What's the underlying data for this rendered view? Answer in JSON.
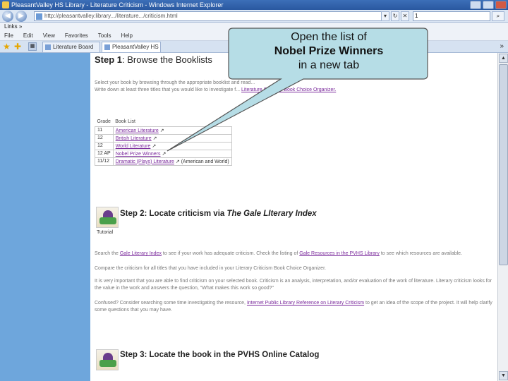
{
  "window": {
    "title": "PleasantValley HS Library - Literature Criticism - Windows Internet Explorer"
  },
  "address_bar": {
    "url": "http://pleasantvalley.library.../literature.../criticism.html",
    "search_value": "1"
  },
  "links_bar": {
    "label": "Links »"
  },
  "menu": [
    "File",
    "Edit",
    "View",
    "Favorites",
    "Tools",
    "Help"
  ],
  "tabs": [
    {
      "label": "Literature Board"
    },
    {
      "label": "PleasantValley HS Library"
    }
  ],
  "step1": {
    "number_label": "Step 1",
    "title_rest": ": Browse the Booklists",
    "instructions_line1": "Select your book by browsing through the appropriate booklist and read...",
    "instructions_line2_prefix": "Write down at least three titles that you would like to investigate f...",
    "organizer_link": "Literature Criticism Book Choice Organizer.",
    "table": {
      "headers": [
        "Grade",
        "Book List"
      ],
      "rows": [
        {
          "grade": "11",
          "list": "American Literature"
        },
        {
          "grade": "12",
          "list": "British Literature"
        },
        {
          "grade": "12",
          "list": "World Literature"
        },
        {
          "grade": "12 AP",
          "list": "Nobel Prize Winners"
        },
        {
          "grade": "11/12",
          "list": "Dramatic (Plays) Literature",
          "note": "(American and World)"
        }
      ]
    }
  },
  "step2": {
    "heading_prefix": "Step 2: Locate criticism via ",
    "heading_italic": "The Gale LIterary Index",
    "tutorial_label": "Tutorial",
    "para1_prefix": "Search the ",
    "para1_link1": "Gale Literary Index",
    "para1_mid": " to see if your work has adequate criticism. Check the listing of ",
    "para1_link2": "Gale Resources in the PVHS Library",
    "para1_suffix": " to see which resources are available.",
    "para2": "Compare the criticism for all titles that you have included in your Literary Criticism Book Choice Organizer.",
    "para3": "It is very important that you are able to find criticism on your selected book. Criticism is an analysis, interpretation, and/or evaluation of the work of literature. Literary criticism looks for the value in the work and answers the question, \"What makes this work so good?\"",
    "para4_prefix": "Confused? Consider searching some time investigating the resource, ",
    "para4_link": "Internet Public Library Reference on Literary Criticism",
    "para4_suffix": " to get an idea of the scope of the project. It will help clarify some questions that you may have."
  },
  "step3": {
    "heading": "Step 3: Locate the book in the PVHS Online Catalog"
  },
  "callout": {
    "line1": "Open the list of",
    "line2": "Nobel Prize Winners",
    "line3": "in a new tab"
  },
  "colors": {
    "sidebar": "#6ea6dc",
    "callout_fill": "#b6dde6",
    "link": "#7b2b9c"
  }
}
